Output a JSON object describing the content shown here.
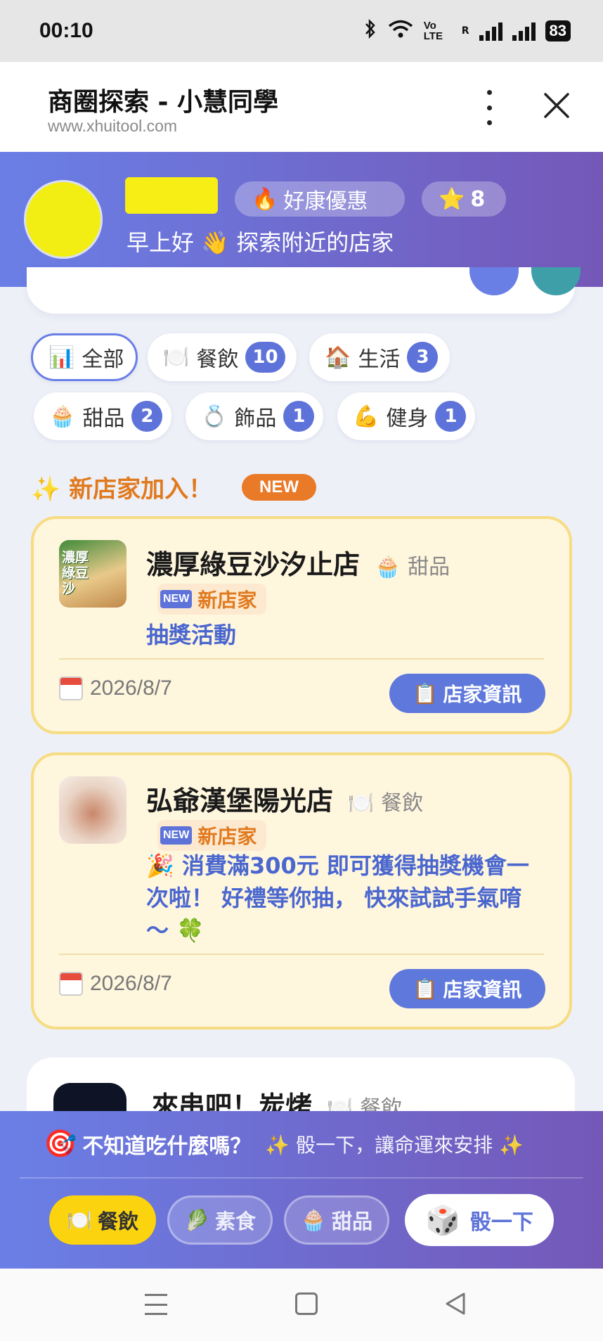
{
  "status_bar": {
    "time": "00:10",
    "battery": "83",
    "network_label": "Vo LTE",
    "roaming": "R"
  },
  "browser": {
    "title": "商圈探索 - 小慧同學",
    "url": "www.xhuitool.com"
  },
  "hero": {
    "deal_icon": "🔥",
    "deal_label": "好康優惠",
    "star_icon": "⭐",
    "star_count": "8",
    "greeting": "早上好 👋 探索附近的店家"
  },
  "categories": [
    {
      "icon": "📊",
      "label": "全部",
      "count": null
    },
    {
      "icon": "🍽️",
      "label": "餐飲",
      "count": "10"
    },
    {
      "icon": "🏠",
      "label": "生活",
      "count": "3"
    },
    {
      "icon": "🧁",
      "label": "甜品",
      "count": "2"
    },
    {
      "icon": "💍",
      "label": "飾品",
      "count": "1"
    },
    {
      "icon": "💪",
      "label": "健身",
      "count": "1"
    }
  ],
  "new_section": {
    "title": "✨ 新店家加入！",
    "badge": "NEW"
  },
  "shops": [
    {
      "name": "濃厚綠豆沙汐止店",
      "category_icon": "🧁",
      "category": "甜品",
      "new_badge": "NEW",
      "new_label": "新店家",
      "description": "抽獎活動",
      "date": "2026/8/7",
      "info_button": "店家資訊",
      "info_icon": "📋",
      "logo_text": "濃厚綠豆沙"
    },
    {
      "name": "弘爺漢堡陽光店",
      "category_icon": "🍽️",
      "category": "餐飲",
      "new_badge": "NEW",
      "new_label": "新店家",
      "description": "🎉 消費滿300元 即可獲得抽獎機會一次啦！ 好禮等你抽， 快來試試手氣唷～ 🍀",
      "date": "2026/8/7",
      "info_button": "店家資訊",
      "info_icon": "📋"
    },
    {
      "name": "來串吧！炭烤",
      "category_icon": "🍽️",
      "category": "餐飲"
    }
  ],
  "random_panel": {
    "icon": "🎯",
    "question": "不知道吃什麼嗎？",
    "hint": "✨ 骰一下，讓命運來安排 ✨",
    "options": [
      {
        "icon": "🍽️",
        "label": "餐飲",
        "selected": true
      },
      {
        "icon": "🥬",
        "label": "素食",
        "selected": false
      },
      {
        "icon": "🧁",
        "label": "甜品",
        "selected": false
      }
    ],
    "dice_icon": "🎲",
    "dice_label": "骰一下"
  },
  "colors": {
    "accent": "#5e73da",
    "hero_start": "#6a7fe6",
    "hero_end": "#7458b8",
    "new_orange": "#e07a1f",
    "card_bg": "#fff6de",
    "card_border": "#f6dc82",
    "selected_chip": "#fcd30f"
  }
}
